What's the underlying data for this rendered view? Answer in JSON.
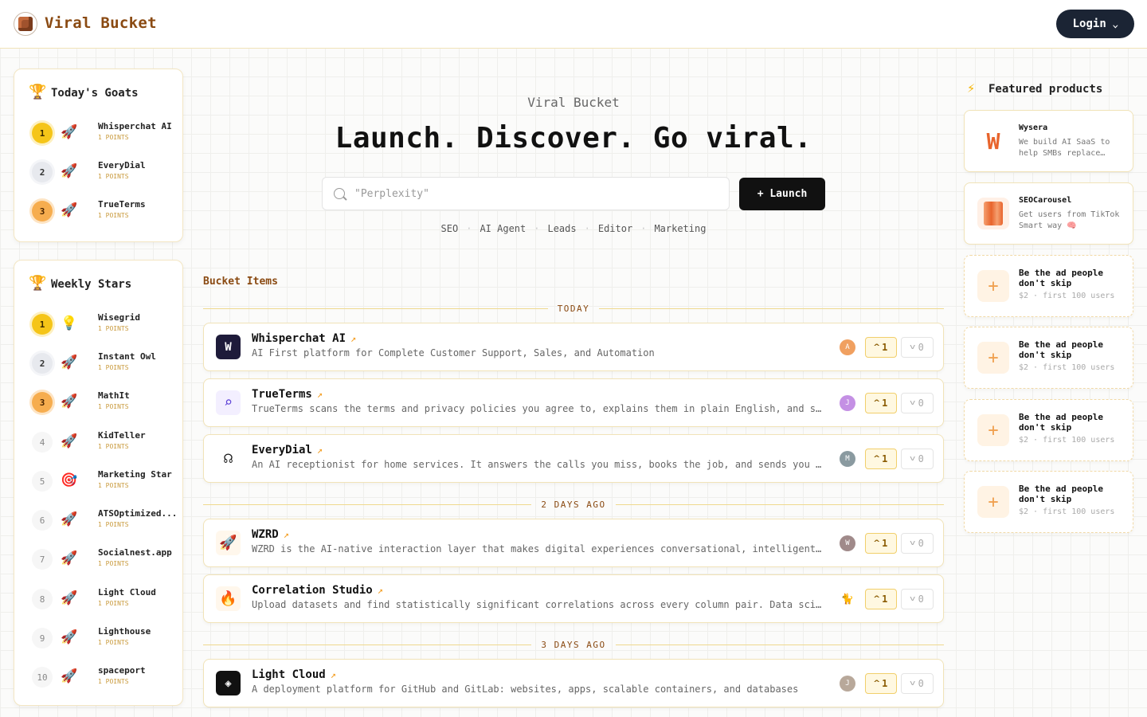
{
  "header": {
    "brand": "Viral Bucket",
    "login_label": "Login"
  },
  "todays_goats": {
    "title": "Today's Goats",
    "items": [
      {
        "rank": "1",
        "name": "Whisperchat AI",
        "points": "1 POINTS"
      },
      {
        "rank": "2",
        "name": "EveryDial",
        "points": "1 POINTS"
      },
      {
        "rank": "3",
        "name": "TrueTerms",
        "points": "1 POINTS"
      }
    ]
  },
  "weekly_stars": {
    "title": "Weekly Stars",
    "items": [
      {
        "rank": "1",
        "name": "Wisegrid",
        "points": "1 POINTS",
        "emoji": "💡"
      },
      {
        "rank": "2",
        "name": "Instant Owl",
        "points": "1 POINTS",
        "emoji": "🚀"
      },
      {
        "rank": "3",
        "name": "MathIt",
        "points": "1 POINTS",
        "emoji": "🚀"
      },
      {
        "rank": "4",
        "name": "KidTeller",
        "points": "1 POINTS",
        "emoji": "🚀"
      },
      {
        "rank": "5",
        "name": "Marketing Star",
        "points": "1 POINTS",
        "emoji": "🎯"
      },
      {
        "rank": "6",
        "name": "ATSOptimized...",
        "points": "1 POINTS",
        "emoji": "🚀"
      },
      {
        "rank": "7",
        "name": "Socialnest.app",
        "points": "1 POINTS",
        "emoji": "🚀"
      },
      {
        "rank": "8",
        "name": "Light Cloud",
        "points": "1 POINTS",
        "emoji": "🚀"
      },
      {
        "rank": "9",
        "name": "Lighthouse",
        "points": "1 POINTS",
        "emoji": "🚀"
      },
      {
        "rank": "10",
        "name": "spaceport",
        "points": "1 POINTS",
        "emoji": "🚀"
      }
    ]
  },
  "hero": {
    "kicker": "Viral Bucket",
    "title": "Launch. Discover. Go viral.",
    "search_placeholder": "\"Perplexity\"",
    "launch_label": "+ Launch",
    "tags": [
      "SEO",
      "AI Agent",
      "Leads",
      "Editor",
      "Marketing"
    ]
  },
  "bucket": {
    "title": "Bucket Items",
    "dividers": [
      "TODAY",
      "2 DAYS AGO",
      "3 DAYS AGO"
    ],
    "items": [
      {
        "name": "Whisperchat AI",
        "desc": "AI First platform for Complete Customer Support, Sales, and Automation",
        "avatar": "A",
        "avatar_color": "#f0a060",
        "up": "1",
        "down": "0",
        "icon": "W"
      },
      {
        "name": "TrueTerms",
        "desc": "TrueTerms scans the terms and privacy policies you agree to, explains them in plain English, and shows you what matters.",
        "avatar": "J",
        "avatar_color": "#c490e4",
        "up": "1",
        "down": "0",
        "icon": "search-doc"
      },
      {
        "name": "EveryDial",
        "desc": "An AI receptionist for home services. It answers the calls you miss, books the job, and sends you the details.",
        "avatar": "M",
        "avatar_color": "#8a9aa0",
        "up": "1",
        "down": "0",
        "icon": "headset"
      },
      {
        "name": "WZRD",
        "desc": "WZRD is the AI-native interaction layer that makes digital experiences conversational, intelligent, and personal.",
        "avatar": "W",
        "avatar_color": "#a08a8a",
        "up": "1",
        "down": "0",
        "icon": "🚀"
      },
      {
        "name": "Correlation Studio",
        "desc": "Upload datasets and find statistically significant correlations across every column pair. Data scientists love it.",
        "avatar": "🐈",
        "avatar_color": "#ffffff",
        "up": "1",
        "down": "0",
        "icon": "🔥"
      },
      {
        "name": "Light Cloud",
        "desc": "A deployment platform for GitHub and GitLab: websites, apps, scalable containers, and databases",
        "avatar": "J",
        "avatar_color": "#b8a89a",
        "up": "1",
        "down": "0",
        "icon": "cloud"
      }
    ]
  },
  "featured": {
    "title": "Featured products",
    "products": [
      {
        "name": "Wysera",
        "desc": "We build AI SaaS to help SMBs replace…"
      },
      {
        "name": "SEOCarousel",
        "desc": "Get users from TikTok Smart way 🧠"
      }
    ],
    "ads": [
      {
        "title": "Be the ad people don't skip",
        "sub": "$2 · first 100 users"
      },
      {
        "title": "Be the ad people don't skip",
        "sub": "$2 · first 100 users"
      },
      {
        "title": "Be the ad people don't skip",
        "sub": "$2 · first 100 users"
      },
      {
        "title": "Be the ad people don't skip",
        "sub": "$2 · first 100 users"
      }
    ]
  },
  "colors": {
    "accent": "#8a4a12",
    "upvote_bg": "#fff8e1",
    "primary_button": "#111111"
  }
}
